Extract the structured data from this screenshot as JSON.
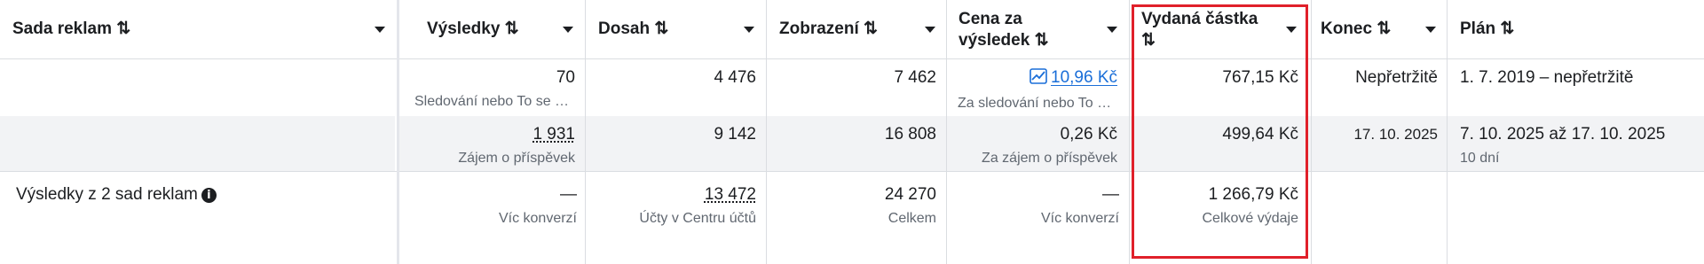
{
  "headers": {
    "adset": "Sada reklam ⇅",
    "results": "Výsledky ⇅",
    "reach": "Dosah ⇅",
    "impressions": "Zobrazení ⇅",
    "cpr_line1": "Cena za",
    "cpr_line2": "výsledek ⇅",
    "spent_line1": "Vydaná částka",
    "spent_line2": "⇅",
    "end": "Konec ⇅",
    "plan": "Plán ⇅"
  },
  "rows": [
    {
      "results": "70",
      "results_sub": "Sledování nebo To se …",
      "reach": "4 476",
      "impressions": "7 462",
      "cpr": "10,96 Kč",
      "cpr_sub": "Za sledování nebo To …",
      "spent": "767,15 Kč",
      "end": "Nepřetržitě",
      "plan": "1. 7. 2019 – nepřetržitě"
    },
    {
      "results": "1 931",
      "results_sub": "Zájem o příspěvek",
      "reach": "9 142",
      "impressions": "16 808",
      "cpr": "0,26 Kč",
      "cpr_sub": "Za zájem o příspěvek",
      "spent": "499,64 Kč",
      "end": "17. 10. 2025",
      "plan": "7. 10. 2025 až 17. 10. 2025",
      "plan_sub": "10 dní"
    }
  ],
  "summary": {
    "label": "Výsledky z 2 sad reklam",
    "results": "—",
    "results_sub": "Víc konverzí",
    "reach": "13 472",
    "reach_sub": "Účty v Centru účtů",
    "impressions": "24 270",
    "impressions_sub": "Celkem",
    "cpr": "—",
    "cpr_sub": "Víc konverzí",
    "spent": "1 266,79 Kč",
    "spent_sub": "Celkové výdaje"
  },
  "colors": {
    "highlight": "#e0202a",
    "link": "#1a6ed8"
  }
}
